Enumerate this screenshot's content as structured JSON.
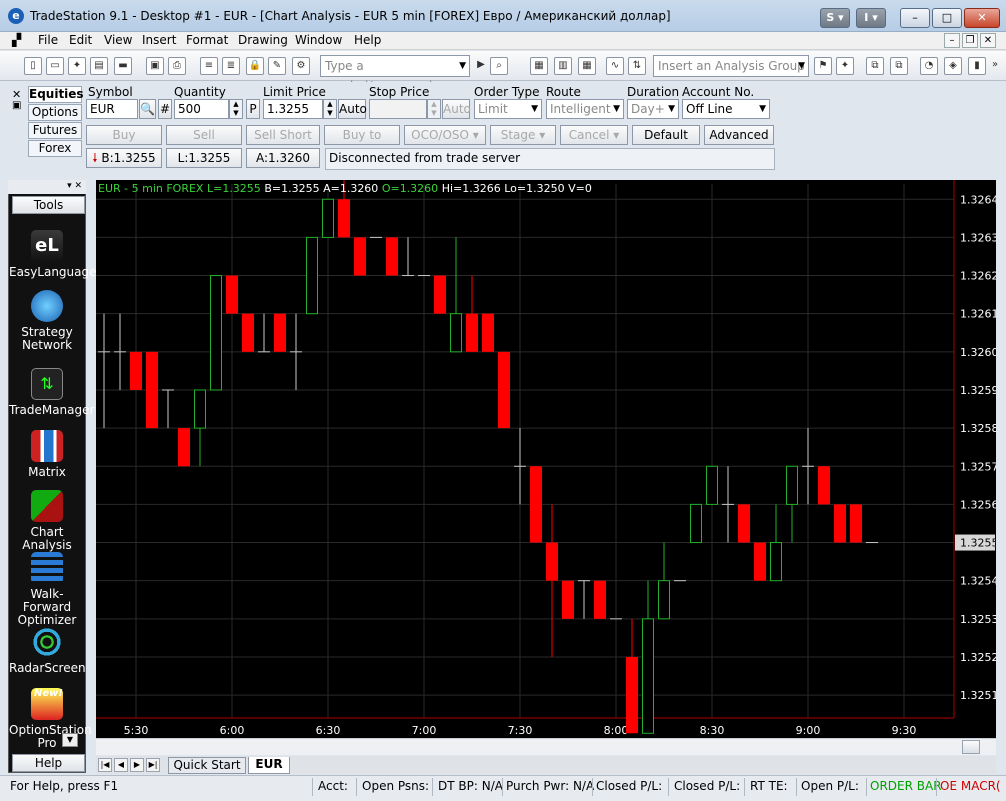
{
  "window": {
    "title": "TradeStation 9.1 - Desktop #1 - EUR - [Chart Analysis - EUR 5 min [FOREX] Евро / Американский доллар]",
    "buttons": {
      "s": "S ▾",
      "i": "I ▾",
      "min": "–",
      "max": "□",
      "close": "✕"
    }
  },
  "menu": [
    "File",
    "Edit",
    "View",
    "Insert",
    "Format",
    "Drawing",
    "Window",
    "Help"
  ],
  "toolbar": {
    "symbol_placeholder": "Type a symbol/command",
    "analysis_group": "Insert an Analysis Group"
  },
  "orderbar": {
    "tabs": [
      "Equities",
      "Options",
      "Futures",
      "Forex"
    ],
    "labels": {
      "symbol": "Symbol",
      "quantity": "Quantity",
      "limit_price": "Limit Price",
      "stop_price": "Stop Price",
      "order_type": "Order Type",
      "route": "Route",
      "duration": "Duration",
      "account_no": "Account No."
    },
    "values": {
      "symbol": "EUR",
      "quantity": "500",
      "limit_price": "1.3255",
      "order_type": "Limit",
      "route": "Intelligent",
      "duration": "Day+",
      "account_no": "Off Line"
    },
    "small_buttons": {
      "search": "🔍",
      "hash": "#",
      "p": "P",
      "auto1": "Auto",
      "auto2": "Auto"
    },
    "buttons": {
      "buy": "Buy",
      "sell": "Sell",
      "sell_short": "Sell Short",
      "buy_to_cover": "Buy to Cover",
      "oco_oso": "OCO/OSO",
      "stage": "Stage",
      "cancel": "Cancel",
      "default": "Default",
      "advanced": "Advanced >>"
    },
    "quotes": {
      "bid": "B:1.3255",
      "last": "L:1.3255",
      "ask": "A:1.3260"
    },
    "message": "Disconnected from trade server"
  },
  "tools": {
    "title": "Tools",
    "items": [
      {
        "label": "EasyLanguage",
        "name": "easylanguage-icon"
      },
      {
        "label": "Strategy Network",
        "name": "strategy-network-icon"
      },
      {
        "label": "TradeManager",
        "name": "trademanager-icon"
      },
      {
        "label": "Matrix",
        "name": "matrix-icon"
      },
      {
        "label": "Chart Analysis",
        "name": "chart-analysis-icon"
      },
      {
        "label": "Walk-Forward Optimizer",
        "name": "walk-forward-icon"
      },
      {
        "label": "RadarScreen",
        "name": "radarscreen-icon"
      },
      {
        "label": "OptionStation Pro",
        "name": "optionstation-icon"
      }
    ],
    "new_badge": "New!",
    "help": "Help"
  },
  "chart_header": {
    "symbol": "EUR - 5 min  FOREX",
    "last": "L=1.3255",
    "bid": "B=1.3255",
    "ask": "A=1.3260",
    "open": "O=1.3260",
    "high": "Hi=1.3266",
    "low": "Lo=1.3250",
    "volume": "V=0"
  },
  "chart_data": {
    "type": "candlestick",
    "x_labels": [
      "5:30",
      "6:00",
      "6:30",
      "7:00",
      "7:30",
      "8:00",
      "8:30",
      "9:00",
      "9:30"
    ],
    "y_ticks": [
      "1.3264",
      "1.3263",
      "1.3262",
      "1.3261",
      "1.3260",
      "1.3259",
      "1.3258",
      "1.3257",
      "1.3256",
      "1.3255",
      "1.3254",
      "1.3253",
      "1.3252",
      "1.3251"
    ],
    "ylim": [
      1.32504,
      1.32644
    ],
    "current_price": "1.3255",
    "candles": [
      {
        "o": 1.326,
        "h": 1.3261,
        "l": 1.3258,
        "c": 1.326
      },
      {
        "o": 1.326,
        "h": 1.3261,
        "l": 1.3259,
        "c": 1.326
      },
      {
        "o": 1.326,
        "h": 1.326,
        "l": 1.3259,
        "c": 1.3259
      },
      {
        "o": 1.326,
        "h": 1.326,
        "l": 1.3258,
        "c": 1.3258
      },
      {
        "o": 1.3259,
        "h": 1.3259,
        "l": 1.3258,
        "c": 1.3259
      },
      {
        "o": 1.3258,
        "h": 1.3258,
        "l": 1.3257,
        "c": 1.3257
      },
      {
        "o": 1.3258,
        "h": 1.3259,
        "l": 1.3257,
        "c": 1.3259
      },
      {
        "o": 1.3259,
        "h": 1.3262,
        "l": 1.3259,
        "c": 1.3262
      },
      {
        "o": 1.3262,
        "h": 1.3262,
        "l": 1.3261,
        "c": 1.3261
      },
      {
        "o": 1.3261,
        "h": 1.3261,
        "l": 1.326,
        "c": 1.326
      },
      {
        "o": 1.326,
        "h": 1.3261,
        "l": 1.326,
        "c": 1.326
      },
      {
        "o": 1.3261,
        "h": 1.3261,
        "l": 1.326,
        "c": 1.326
      },
      {
        "o": 1.326,
        "h": 1.3261,
        "l": 1.3259,
        "c": 1.326
      },
      {
        "o": 1.3261,
        "h": 1.3263,
        "l": 1.3261,
        "c": 1.3263
      },
      {
        "o": 1.3263,
        "h": 1.3264,
        "l": 1.3263,
        "c": 1.3264
      },
      {
        "o": 1.3264,
        "h": 1.3265,
        "l": 1.3263,
        "c": 1.3263
      },
      {
        "o": 1.3263,
        "h": 1.3263,
        "l": 1.3262,
        "c": 1.3262
      },
      {
        "o": 1.3263,
        "h": 1.3263,
        "l": 1.3263,
        "c": 1.3263
      },
      {
        "o": 1.3263,
        "h": 1.3263,
        "l": 1.3262,
        "c": 1.3262
      },
      {
        "o": 1.3262,
        "h": 1.3263,
        "l": 1.3262,
        "c": 1.3262
      },
      {
        "o": 1.3262,
        "h": 1.3262,
        "l": 1.3262,
        "c": 1.3262
      },
      {
        "o": 1.3262,
        "h": 1.3262,
        "l": 1.3261,
        "c": 1.3261
      },
      {
        "o": 1.326,
        "h": 1.3263,
        "l": 1.326,
        "c": 1.3261
      },
      {
        "o": 1.3261,
        "h": 1.3262,
        "l": 1.326,
        "c": 1.326
      },
      {
        "o": 1.3261,
        "h": 1.3261,
        "l": 1.326,
        "c": 1.326
      },
      {
        "o": 1.326,
        "h": 1.326,
        "l": 1.3258,
        "c": 1.3258
      },
      {
        "o": 1.3257,
        "h": 1.3258,
        "l": 1.3256,
        "c": 1.3257
      },
      {
        "o": 1.3257,
        "h": 1.3257,
        "l": 1.3255,
        "c": 1.3255
      },
      {
        "o": 1.3255,
        "h": 1.3256,
        "l": 1.3252,
        "c": 1.3254
      },
      {
        "o": 1.3254,
        "h": 1.3254,
        "l": 1.3253,
        "c": 1.3253
      },
      {
        "o": 1.3254,
        "h": 1.3254,
        "l": 1.3253,
        "c": 1.3254
      },
      {
        "o": 1.3254,
        "h": 1.3254,
        "l": 1.3253,
        "c": 1.3253
      },
      {
        "o": 1.3253,
        "h": 1.3253,
        "l": 1.3253,
        "c": 1.3253
      },
      {
        "o": 1.3252,
        "h": 1.3253,
        "l": 1.325,
        "c": 1.325
      },
      {
        "o": 1.325,
        "h": 1.3254,
        "l": 1.325,
        "c": 1.3253
      },
      {
        "o": 1.3253,
        "h": 1.3255,
        "l": 1.3253,
        "c": 1.3254
      },
      {
        "o": 1.3254,
        "h": 1.3254,
        "l": 1.3254,
        "c": 1.3254
      },
      {
        "o": 1.3255,
        "h": 1.3256,
        "l": 1.3255,
        "c": 1.3256
      },
      {
        "o": 1.3256,
        "h": 1.3257,
        "l": 1.3256,
        "c": 1.3257
      },
      {
        "o": 1.3256,
        "h": 1.3257,
        "l": 1.3255,
        "c": 1.3256
      },
      {
        "o": 1.3256,
        "h": 1.3256,
        "l": 1.3255,
        "c": 1.3255
      },
      {
        "o": 1.3255,
        "h": 1.3255,
        "l": 1.3254,
        "c": 1.3254
      },
      {
        "o": 1.3254,
        "h": 1.3256,
        "l": 1.3254,
        "c": 1.3255
      },
      {
        "o": 1.3256,
        "h": 1.3257,
        "l": 1.3255,
        "c": 1.3257
      },
      {
        "o": 1.3257,
        "h": 1.3258,
        "l": 1.3256,
        "c": 1.3257
      },
      {
        "o": 1.3257,
        "h": 1.3257,
        "l": 1.3256,
        "c": 1.3256
      },
      {
        "o": 1.3256,
        "h": 1.3256,
        "l": 1.3255,
        "c": 1.3255
      },
      {
        "o": 1.3256,
        "h": 1.3256,
        "l": 1.3255,
        "c": 1.3255
      },
      {
        "o": 1.3255,
        "h": 1.3255,
        "l": 1.3255,
        "c": 1.3255
      }
    ]
  },
  "colors": {
    "up": "#22b02a",
    "down": "#ff0000",
    "flat": "#c8c8c8",
    "header_green": "#3cd23c",
    "grid": "#2a2a2a",
    "axis_line": "#b00000",
    "order_bar_green": "#00a000",
    "oe_macro_red": "#d00000"
  },
  "sheets": {
    "nav": [
      "|◀",
      "◀",
      "▶",
      "▶|"
    ],
    "tabs": [
      "Quick Start",
      "EUR"
    ]
  },
  "statusbar": {
    "help": "For Help, press F1",
    "acct": "Acct:",
    "open_psns": "Open Psns:",
    "dt_bp": "DT BP: N/A",
    "purch_pwr": "Purch Pwr: N/A",
    "closed_pl1": "Closed P/L:",
    "closed_pl2": "Closed P/L:",
    "rt_te": "RT TE:",
    "open_pl": "Open P/L:",
    "order_bar": "ORDER BAR",
    "oe_macro": "OE MACR("
  }
}
